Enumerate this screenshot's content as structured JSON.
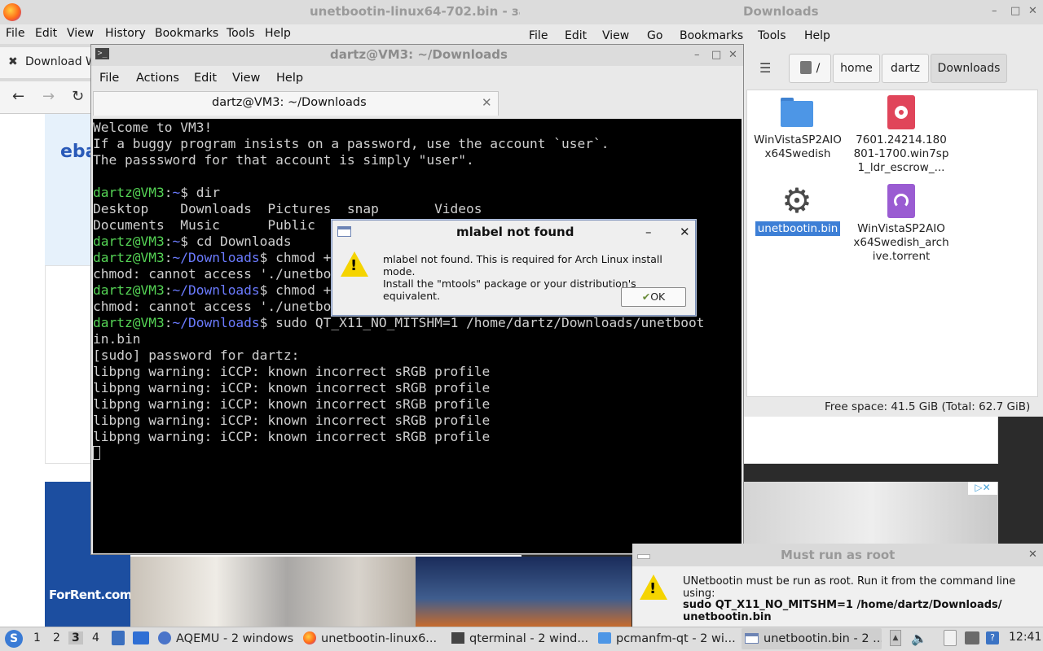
{
  "firefox": {
    "title": "unetbootin-linux64-702.bin - за",
    "menu": [
      "File",
      "Edit",
      "View",
      "History",
      "Bookmarks",
      "Tools",
      "Help"
    ],
    "tab_label": "Download W",
    "ebay_logo": "eba",
    "ad_brand": "ForRent.com",
    "ad_badge": "▷✕"
  },
  "file_manager": {
    "title": "Downloads",
    "menu": [
      "File",
      "Edit",
      "View",
      "Go",
      "Bookmarks",
      "Tools",
      "Help"
    ],
    "breadcrumb": [
      "/",
      "home",
      "dartz",
      "Downloads"
    ],
    "items": [
      {
        "name": "WinVistaSP2AIO x64Swedish",
        "icon": "folder-icon"
      },
      {
        "name": "7601.24214.180 801-1700.win7sp 1_ldr_escrow_...",
        "icon": "disc-image-icon"
      },
      {
        "name": "unetbootin.bin",
        "icon": "gear-icon",
        "selected": true
      },
      {
        "name": "WinVistaSP2AIO x64Swedish_arch ive.torrent",
        "icon": "torrent-icon"
      }
    ],
    "status": "Free space: 41.5 GiB (Total: 62.7 GiB)"
  },
  "terminal": {
    "title": "dartz@VM3: ~/Downloads",
    "menu": [
      "File",
      "Actions",
      "Edit",
      "View",
      "Help"
    ],
    "tab_label": "dartz@VM3: ~/Downloads",
    "lines": [
      "Welcome to VM3!",
      "If a buggy program insists on a password, use the account `user`.",
      "The passsword for that account is simply \"user\".",
      "",
      "dartz@VM3:~$ dir",
      "Desktop    Downloads  Pictures  snap       Videos",
      "Documents  Music      Public    Templates",
      "dartz@VM3:~$ cd Downloads",
      "dartz@VM3:~/Downloads$ chmod +x ./unetbootin.bin",
      "chmod: cannot access './unetbootin.bin': No such file",
      "dartz@VM3:~/Downloads$ chmod +x ./unetbootin.bin",
      "chmod: cannot access './unetbootin.bin': No such file",
      "dartz@VM3:~/Downloads$ sudo QT_X11_NO_MITSHM=1 /home/dartz/Downloads/unetboot",
      "in.bin",
      "[sudo] password for dartz:",
      "libpng warning: iCCP: known incorrect sRGB profile",
      "libpng warning: iCCP: known incorrect sRGB profile",
      "libpng warning: iCCP: known incorrect sRGB profile",
      "libpng warning: iCCP: known incorrect sRGB profile",
      "libpng warning: iCCP: known incorrect sRGB profile"
    ]
  },
  "dialog_mlabel": {
    "title": "mlabel not found",
    "message_1": "mlabel not found. This is required for Arch Linux install mode.",
    "message_2": "Install the \"mtools\" package or your distribution's equivalent.",
    "ok_label": "OK"
  },
  "dialog_root": {
    "title": "Must run as root",
    "message_1": "UNetbootin must be run as root. Run it from the command line using:",
    "message_2": "sudo QT_X11_NO_MITSHM=1 /home/dartz/Downloads/",
    "message_3": "unetbootin.bin"
  },
  "taskbar": {
    "workspaces": [
      "1",
      "2",
      "3",
      "4"
    ],
    "active_workspace": "3",
    "tasks": [
      {
        "label": "AQEMU - 2 windows",
        "icon": "qemu-icon"
      },
      {
        "label": "unetbootin-linux6...",
        "icon": "firefox-icon"
      },
      {
        "label": "qterminal - 2 wind...",
        "icon": "terminal-icon"
      },
      {
        "label": "pcmanfm-qt - 2 wi...",
        "icon": "folder-icon"
      },
      {
        "label": "unetbootin.bin - 2 ...",
        "icon": "window-icon",
        "active": true
      }
    ],
    "clock": "12:41"
  }
}
